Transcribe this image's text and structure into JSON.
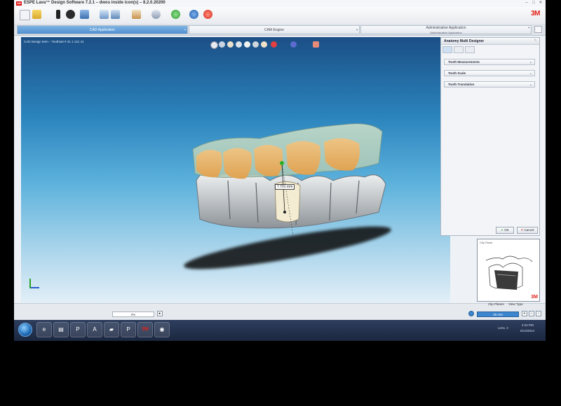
{
  "window": {
    "title": "ESPE Lava™ Design Software 7.2.1 – dwos inside icon(s) – 8.2.0.20200",
    "logo_text": "3M",
    "brand": "3M",
    "controls": [
      "–",
      "□",
      "✕"
    ]
  },
  "tabs": [
    {
      "label": "CAD Application",
      "active": true
    },
    {
      "label": "CAM Engine",
      "active": false
    },
    {
      "label": "Administrative Application",
      "sublabel": "Administrative Application",
      "active": false
    }
  ],
  "viewport": {
    "label": "CAD Design Item – Toothset # 41 1 141 41",
    "measurement": "7.701 mm"
  },
  "panel": {
    "title": "Anatomy Multi Designer",
    "pin": "ᛋ",
    "sections": [
      {
        "label": "Tooth Measurements"
      },
      {
        "label": "Tooth Scale"
      },
      {
        "label": "Tooth Translation"
      }
    ],
    "ok_label": "OK",
    "cancel_label": "Cancel"
  },
  "minimap": {
    "label": "Clip Plane",
    "brand": "3M"
  },
  "status": {
    "progress_text": "0%",
    "zoom_text": "25 mm",
    "clip_planes_label": "Clip Planes",
    "view_type_label": "View Type"
  },
  "taskbar": {
    "tray_time": "4:22 PM",
    "tray_date": "5/14/2014",
    "tray_lang": "Lens, 3"
  },
  "colors": {
    "accent": "#4f8fcf",
    "brand_red": "#e2231a",
    "viewport_top": "#1b4f86",
    "viewport_bottom": "#e3eff7"
  }
}
